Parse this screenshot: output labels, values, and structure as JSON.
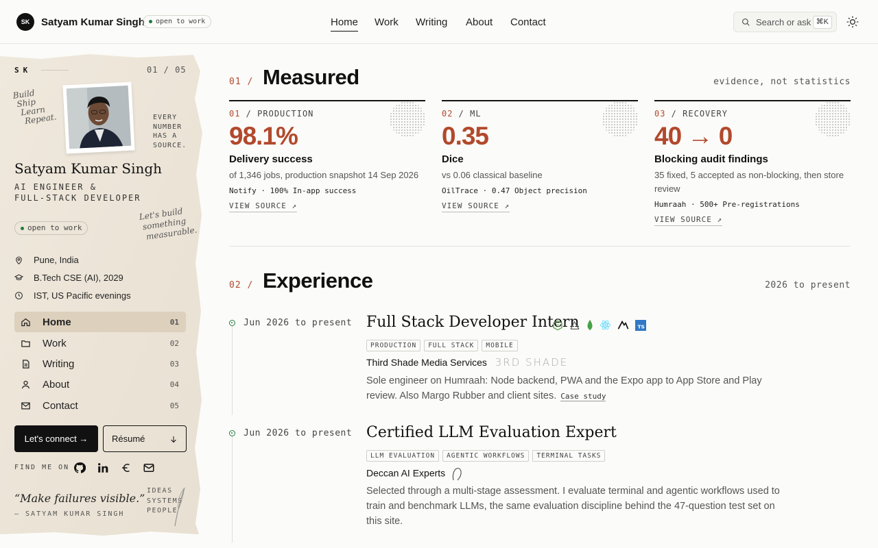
{
  "header": {
    "initials": "SK",
    "name": "Satyam Kumar Singh",
    "status_badge": "open to work",
    "nav": [
      {
        "label": "Home",
        "active": true
      },
      {
        "label": "Work"
      },
      {
        "label": "Writing"
      },
      {
        "label": "About"
      },
      {
        "label": "Contact"
      }
    ],
    "search_placeholder": "Search or ask",
    "search_shortcut": "⌘K"
  },
  "sidebar": {
    "mark": "SK",
    "page_counter": "01 / 05",
    "handwritten_motto": [
      "Build",
      "Ship",
      "Learn",
      "Repeat."
    ],
    "every_number": [
      "EVERY",
      "NUMBER",
      "HAS A",
      "SOURCE."
    ],
    "name": "Satyam Kumar Singh",
    "role_lines": [
      "AI ENGINEER &",
      "FULL-STACK DEVELOPER"
    ],
    "status_badge": "open to work",
    "lets_build": [
      "Let's build",
      "something",
      "measurable."
    ],
    "info": [
      {
        "icon": "location-pin-icon",
        "text": "Pune, India"
      },
      {
        "icon": "graduation-cap-icon",
        "text": "B.Tech CSE (AI), 2029"
      },
      {
        "icon": "clock-icon",
        "text": "IST, US Pacific evenings"
      }
    ],
    "nav": [
      {
        "label": "Home",
        "num": "01",
        "icon": "home-icon",
        "active": true
      },
      {
        "label": "Work",
        "num": "02",
        "icon": "folder-icon"
      },
      {
        "label": "Writing",
        "num": "03",
        "icon": "document-icon"
      },
      {
        "label": "About",
        "num": "04",
        "icon": "user-icon"
      },
      {
        "label": "Contact",
        "num": "05",
        "icon": "mail-icon"
      }
    ],
    "connect_label": "Let's connect →",
    "resume_label": "Résumé",
    "find_me_label": "FIND ME ON",
    "socials": [
      "github-icon",
      "linkedin-icon",
      "medium-icon",
      "email-icon"
    ],
    "quote": "“Make failures visible.”",
    "quote_by": "— SATYAM KUMAR SINGH",
    "ideas": [
      "IDEAS",
      "SYSTEMS",
      "PEOPLE"
    ]
  },
  "measured": {
    "num": "01 /",
    "title": "Measured",
    "right_note": "evidence, not statistics",
    "cards": [
      {
        "idx": "01",
        "tag": "PRODUCTION",
        "big": "98.1%",
        "label": "Delivery success",
        "desc": "of 1,346 jobs, production snapshot 14 Sep 2026",
        "meta": "Notify · 100% In-app success",
        "link": "VIEW SOURCE ↗"
      },
      {
        "idx": "02",
        "tag": "ML",
        "big": "0.35",
        "label": "Dice",
        "desc": "vs 0.06 classical baseline",
        "meta": "OilTrace · 0.47 Object precision",
        "link": "VIEW SOURCE ↗"
      },
      {
        "idx": "03",
        "tag": "RECOVERY",
        "big": "40 → 0",
        "label": "Blocking audit findings",
        "desc": "35 fixed, 5 accepted as non-blocking, then store review",
        "meta": "Humraah · 500+ Pre-registrations",
        "link": "VIEW SOURCE ↗"
      }
    ]
  },
  "experience": {
    "num": "02 /",
    "title": "Experience",
    "right_note": "2026 to present",
    "jobs": [
      {
        "date": "Jun 2026 to present",
        "title": "Full Stack Developer Intern",
        "tech": [
          "nodejs-icon",
          "expo-icon",
          "mongodb-icon",
          "react-icon",
          "nestjs-icon",
          "typescript-icon"
        ],
        "chips": [
          "PRODUCTION",
          "FULL STACK",
          "MOBILE"
        ],
        "company": "Third Shade Media Services",
        "company_logo_text": "3RD SHADE",
        "desc": "Sole engineer on Humraah: Node backend, PWA and the Expo app to App Store and Play review. Also Margo Rubber and client sites.",
        "link": "Case study"
      },
      {
        "date": "Jun 2026 to present",
        "title": "Certified LLM Evaluation Expert",
        "chips": [
          "LLM EVALUATION",
          "AGENTIC WORKFLOWS",
          "TERMINAL TASKS"
        ],
        "company": "Deccan AI Experts",
        "desc": "Selected through a multi-stage assessment. I evaluate terminal and agentic workflows used to train and benchmark LLMs, the same evaluation discipline behind the 47-question test set on this site."
      }
    ]
  }
}
